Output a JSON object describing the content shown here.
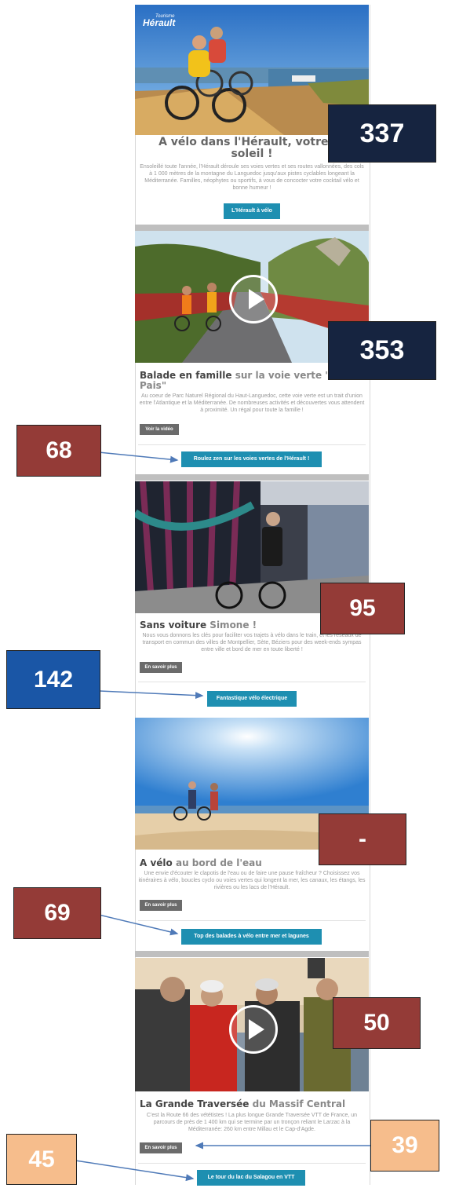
{
  "logo": {
    "small": "Tourisme",
    "big": "Hérault"
  },
  "sections": [
    {
      "title_dark": "A vélo dans l'Hérault, votre ro",
      "title_line2": "soleil !",
      "body": "Ensoleillé toute l'année, l'Hérault déroule ses voies vertes et ses routes vallonnées, des cols à 1 000 mètres de la montagne du Languedoc jusqu'aux pistes cyclables longeant la Méditerranée. Familles, néophytes ou sportifs, à vous de concocter votre cocktail vélo et bonne humeur !",
      "cta": "L'Hérault à vélo",
      "badge": "337"
    },
    {
      "title_dark": "Balade en famille",
      "title_light": " sur la voie verte \"",
      "title_line2": "Pais\"",
      "body": "Au coeur de Parc Naturel Régional du Haut-Languedoc, cette voie verte est un trait d'union entre l'Atlantique et la Méditerranée. De nombreuses activités et découvertes vous attendent à proximité. Un régal pour toute la famille !",
      "secondary": "Voir la vidéo",
      "cta": "Roulez zen sur les voies vertes de l'Hérault !",
      "badge": "353",
      "badge2": "68"
    },
    {
      "title_dark": "Sans voiture",
      "title_light": " Simone !",
      "body": "Nous vous donnons les clés pour faciliter vos trajets à vélo dans le train, et les réseaux de transport en commun des villes de Montpellier, Sète, Béziers pour des week-ends sympas entre ville et bord de mer en toute liberté !",
      "secondary": "En savoir plus",
      "cta": "Fantastique vélo électrique",
      "badge": "95",
      "badge2": "142"
    },
    {
      "title_dark": "A vélo",
      "title_light": " au bord de l'eau",
      "body": "Une envie d'écouter le clapotis de l'eau ou de faire une pause fraîcheur ? Choisissez vos itinéraires à vélo, boucles cyclo ou voies vertes qui longent la mer, les canaux, les étangs, les rivières ou les lacs de l'Hérault.",
      "secondary": "En savoir plus",
      "cta": "Top des balades à vélo entre mer et lagunes",
      "badge": "-",
      "badge2": "69"
    },
    {
      "title_dark": "La Grande Traversée",
      "title_light": " du Massif Central",
      "body": "C'est la Route 66 des vététistes ! La plus longue Grande Traversée VTT de France, un parcours de près de 1 400 km qui se termine par un tronçon reliant le Larzac à la Méditerranée: 260 km entre Millau et le Cap-d'Agde.",
      "secondary": "En savoir plus",
      "cta": "Le tour du lac du Salagou en VTT",
      "badge": "50",
      "badge2": "39",
      "badge3": "45"
    }
  ],
  "colors": {
    "navy": "#162440",
    "red": "#943b37",
    "blue": "#1a56a6",
    "peach": "#f6bd8c",
    "button": "#1e8fb1"
  }
}
